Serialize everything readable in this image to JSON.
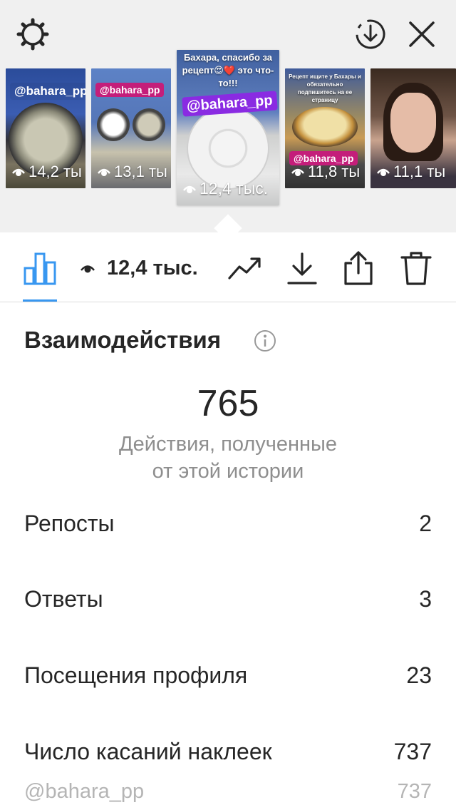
{
  "stories": [
    {
      "tag": "@bahara_pp",
      "views": "14,2 ты"
    },
    {
      "tag": "@bahara_pp",
      "views": "13,1 ты"
    },
    {
      "caption": "Бахара, спасибо за рецепт😍❤️ это что-то!!!",
      "tag": "@bahara_pp",
      "views": "12,4 тыс."
    },
    {
      "caption": "Рецепт ищите у Бахары и обязательно подпишитесь на ее страницу",
      "tag": "@bahara_pp",
      "views": "11,8 ты"
    },
    {
      "views": "11,1 ты"
    }
  ],
  "toolbar": {
    "views": "12,4 тыс."
  },
  "interactions": {
    "title": "Взаимодействия",
    "total": "765",
    "caption_line1": "Действия, полученные",
    "caption_line2": "от этой истории",
    "metrics": [
      {
        "label": "Репосты",
        "value": "2"
      },
      {
        "label": "Ответы",
        "value": "3"
      },
      {
        "label": "Посещения профиля",
        "value": "23"
      },
      {
        "label": "Число касаний наклеек",
        "value": "737"
      }
    ],
    "sticker": {
      "label": "@bahara_pp",
      "value": "737"
    }
  },
  "colors": {
    "accent": "#3897f0",
    "tag_pink": "#c41e7a",
    "tag_purple": "#8a2be2"
  },
  "icons": [
    "settings-icon",
    "download-circle-icon",
    "close-icon",
    "eye-icon",
    "bar-chart-icon",
    "trend-icon",
    "download-icon",
    "share-icon",
    "trash-icon",
    "info-icon"
  ]
}
